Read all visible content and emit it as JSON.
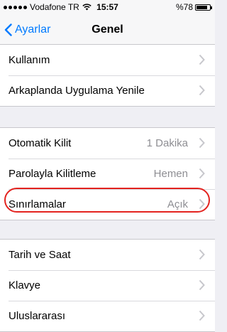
{
  "statusbar": {
    "carrier": "Vodafone TR",
    "time": "15:57",
    "battery": "%78"
  },
  "navbar": {
    "back_label": "Ayarlar",
    "title": "Genel"
  },
  "groups": [
    {
      "rows": [
        {
          "label": "Kullanım",
          "value": ""
        },
        {
          "label": "Arkaplanda Uygulama Yenile",
          "value": ""
        }
      ]
    },
    {
      "rows": [
        {
          "label": "Otomatik Kilit",
          "value": "1 Dakika"
        },
        {
          "label": "Parolayla Kilitleme",
          "value": "Hemen"
        },
        {
          "label": "Sınırlamalar",
          "value": "Açık"
        }
      ]
    },
    {
      "rows": [
        {
          "label": "Tarih ve Saat",
          "value": ""
        },
        {
          "label": "Klavye",
          "value": ""
        },
        {
          "label": "Uluslararası",
          "value": ""
        }
      ]
    }
  ],
  "highlight_color": "#e3231f",
  "accent_color": "#007aff"
}
